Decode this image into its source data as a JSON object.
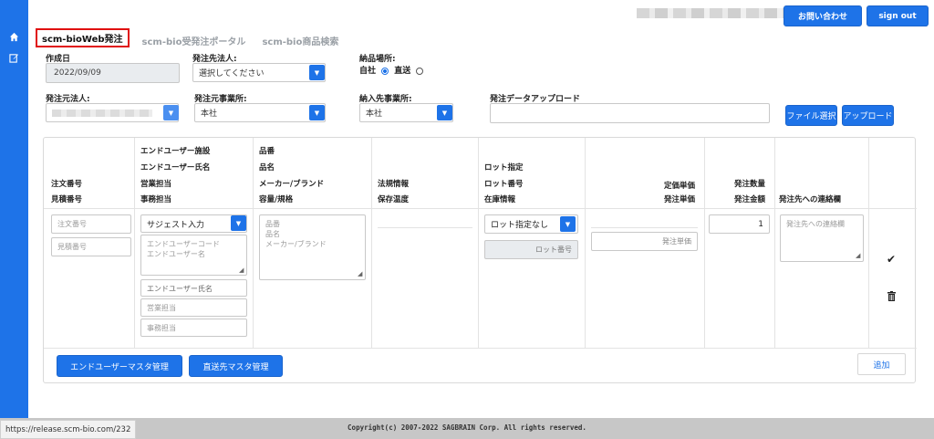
{
  "sidebar": {
    "icons": [
      "home-icon",
      "edit-icon"
    ]
  },
  "header": {
    "contact_button": "お問い合わせ",
    "signout_button": "sign out"
  },
  "tabs": [
    {
      "label": "scm-bioWeb発注",
      "active": true
    },
    {
      "label": "scm-bio受発注ポータル",
      "active": false
    },
    {
      "label": "scm-bio商品検索",
      "active": false
    }
  ],
  "form": {
    "created_date_label": "作成日",
    "created_date_value": "2022/09/09",
    "order_to_label": "発注先法人:",
    "order_to_value": "選択してください",
    "delivery_place_label": "納品場所:",
    "delivery_option_self": "自社",
    "delivery_option_direct": "直送",
    "order_from_label": "発注元法人:",
    "order_from_office_label": "発注元事業所:",
    "order_from_office_value": "本社",
    "delivery_office_label": "納入先事業所:",
    "delivery_office_value": "本社",
    "upload_label": "発注データアップロード",
    "file_select_button": "ファイル選択",
    "upload_button": "アップロード"
  },
  "table": {
    "headers": {
      "col1": [
        "注文番号",
        "見積番号"
      ],
      "col2": [
        "エンドユーザー施設",
        "エンドユーザー氏名",
        "営業担当",
        "事務担当"
      ],
      "col3": [
        "品番",
        "品名",
        "メーカー/ブランド",
        "容量/規格"
      ],
      "col4": [
        "法規情報",
        "保存温度"
      ],
      "col5": [
        "ロット指定",
        "ロット番号",
        "在庫情報"
      ],
      "col6": [
        "定価単価",
        "発注単価"
      ],
      "col7": [
        "発注数量",
        "発注金額"
      ],
      "col8": [
        "発注先への連絡欄"
      ]
    },
    "row": {
      "order_no_placeholder": "注文番号",
      "quote_no_placeholder": "見積番号",
      "suggest_input": "サジェスト入力",
      "enduser_textarea_placeholder": "エンドユーザーコード\nエンドユーザー名",
      "enduser_name_placeholder": "エンドユーザー氏名",
      "sales_placeholder": "営業担当",
      "office_placeholder": "事務担当",
      "product_textarea_placeholder": "品番\n品名\nメーカー/ブランド",
      "lot_select_value": "ロット指定なし",
      "lot_no_placeholder": "ロット番号",
      "unit_price_placeholder": "発注単価",
      "quantity_value": "1",
      "contact_placeholder": "発注先への連絡欄"
    }
  },
  "actions": {
    "enduser_master_button": "エンドユーザーマスタ管理",
    "direct_master_button": "直送先マスタ管理",
    "add_button": "追加"
  },
  "footer": {
    "copyright": "Copyright(c) 2007-2022 SAGBRAIN Corp. All rights reserved.",
    "status_url": "https://release.scm-bio.com/232"
  },
  "colors": {
    "accent": "#1e73e8",
    "tab_active_border": "#e01010"
  }
}
